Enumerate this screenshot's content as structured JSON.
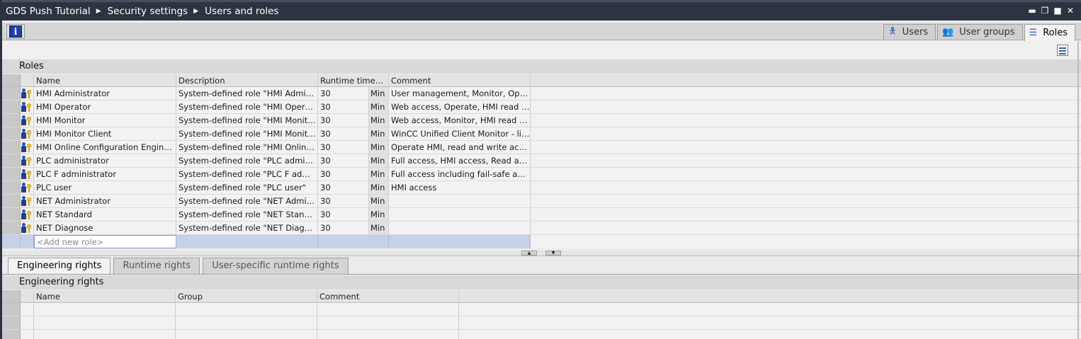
{
  "breadcrumb": [
    "GDS Push Tutorial",
    "Security settings",
    "Users and roles"
  ],
  "window_controls": [
    "minimize",
    "restore",
    "maximize",
    "close"
  ],
  "toolbar": {
    "info_icon": "i"
  },
  "top_tabs": [
    {
      "label": "Users",
      "icon": "user-icon",
      "active": false
    },
    {
      "label": "User groups",
      "icon": "user-groups-icon",
      "active": false
    },
    {
      "label": "Roles",
      "icon": "roles-icon",
      "active": true
    }
  ],
  "roles": {
    "heading": "Roles",
    "columns": {
      "name": "Name",
      "description": "Description",
      "runtime_timeout": "Runtime timeout",
      "comment": "Comment"
    },
    "rows": [
      {
        "name": "HMI Administrator",
        "description": "System-defined role \"HMI Administrator\"",
        "timeout": "30",
        "unit": "Min",
        "comment": "User management, Monitor, Operate"
      },
      {
        "name": "HMI Operator",
        "description": "System-defined role \"HMI Operator\"",
        "timeout": "30",
        "unit": "Min",
        "comment": "Web access, Operate, HMI read access"
      },
      {
        "name": "HMI Monitor",
        "description": "System-defined role \"HMI Monitor\"",
        "timeout": "30",
        "unit": "Min",
        "comment": "Web access, Monitor, HMI read access"
      },
      {
        "name": "HMI Monitor Client",
        "description": "System-defined role \"HMI Monitor Client\"",
        "timeout": "30",
        "unit": "Min",
        "comment": "WinCC Unified Client Monitor - limited"
      },
      {
        "name": "HMI Online Configuration Engineer",
        "description": "System-defined role \"HMI Online Configuration Engineer\"",
        "timeout": "30",
        "unit": "Min",
        "comment": "Operate HMI, read and write access"
      },
      {
        "name": "PLC administrator",
        "description": "System-defined role \"PLC administrator\"",
        "timeout": "30",
        "unit": "Min",
        "comment": "Full access, HMI access, Read access"
      },
      {
        "name": "PLC F administrator",
        "description": "System-defined role \"PLC F administrator\"",
        "timeout": "30",
        "unit": "Min",
        "comment": "Full access including fail-safe access"
      },
      {
        "name": "PLC user",
        "description": "System-defined role \"PLC user\"",
        "timeout": "30",
        "unit": "Min",
        "comment": "HMI access"
      },
      {
        "name": "NET Administrator",
        "description": "System-defined role \"NET Administrator\"",
        "timeout": "30",
        "unit": "Min",
        "comment": ""
      },
      {
        "name": "NET Standard",
        "description": "System-defined role \"NET Standard\"",
        "timeout": "30",
        "unit": "Min",
        "comment": ""
      },
      {
        "name": "NET Diagnose",
        "description": "System-defined role \"NET Diagnose\"",
        "timeout": "30",
        "unit": "Min",
        "comment": ""
      }
    ],
    "add_placeholder": "<Add new role>"
  },
  "bottom_tabs": [
    {
      "label": "Engineering rights",
      "active": true
    },
    {
      "label": "Runtime rights",
      "active": false
    },
    {
      "label": "User-specific runtime rights",
      "active": false
    }
  ],
  "engineering": {
    "heading": "Engineering rights",
    "columns": {
      "name": "Name",
      "group": "Group",
      "comment": "Comment"
    }
  }
}
